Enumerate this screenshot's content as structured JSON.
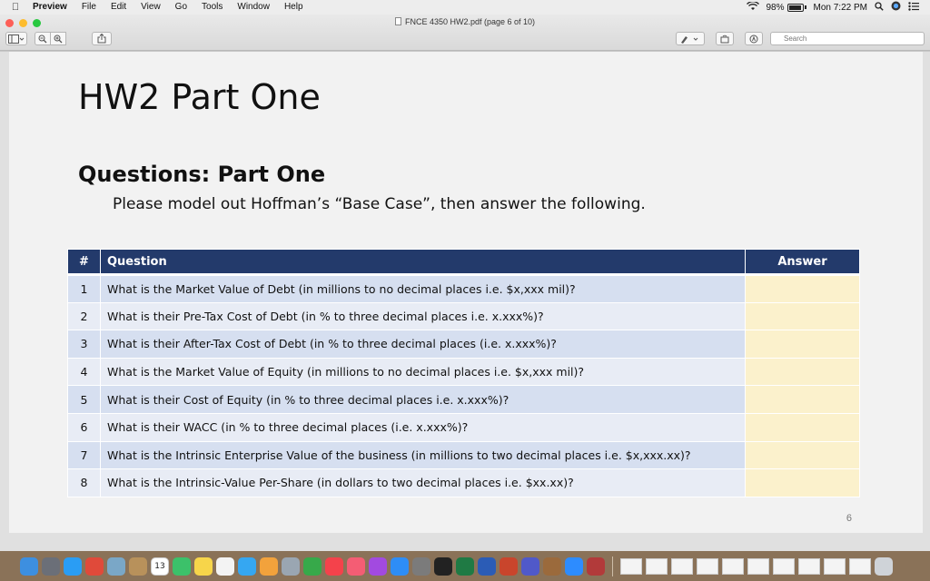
{
  "menubar": {
    "app_name": "Preview",
    "items": [
      "File",
      "Edit",
      "View",
      "Go",
      "Tools",
      "Window",
      "Help"
    ],
    "battery": "98%",
    "battery_level": 0.98,
    "clock": "Mon 7:22 PM"
  },
  "window": {
    "title": "FNCE 4350 HW2.pdf (page 6 of 10)",
    "search_placeholder": "Search"
  },
  "document": {
    "title": "HW2 Part One",
    "section_title": "Questions: Part One",
    "instruction": "Please model out Hoffman’s “Base Case”, then answer the following.",
    "page_number": "6",
    "table": {
      "headers": {
        "num": "#",
        "question": "Question",
        "answer": "Answer"
      },
      "rows": [
        {
          "num": "1",
          "question": "What is the Market Value of Debt (in millions to no decimal places i.e. $x,xxx mil)?",
          "answer": ""
        },
        {
          "num": "2",
          "question": "What is their Pre-Tax Cost of Debt (in % to three decimal places i.e. x.xxx%)?",
          "answer": ""
        },
        {
          "num": "3",
          "question": "What is their After-Tax Cost of Debt (in % to three decimal places (i.e. x.xxx%)?",
          "answer": ""
        },
        {
          "num": "4",
          "question": "What is the Market Value of Equity (in millions to no decimal places i.e. $x,xxx mil)?",
          "answer": ""
        },
        {
          "num": "5",
          "question": "What is their Cost of Equity (in % to three decimal places i.e. x.xxx%)?",
          "answer": ""
        },
        {
          "num": "6",
          "question": "What is their WACC (in % to three decimal places (i.e. x.xxx%)?",
          "answer": ""
        },
        {
          "num": "7",
          "question": "What is the Intrinsic Enterprise Value of the business (in millions to two decimal places i.e. $x,xxx.xx)?",
          "answer": ""
        },
        {
          "num": "8",
          "question": "What is the Intrinsic-Value Per-Share (in dollars to two decimal places i.e. $xx.xx)?",
          "answer": ""
        }
      ]
    }
  },
  "dock": {
    "calendar_day": "13",
    "apps": [
      {
        "icon": "finder-icon",
        "color": "#3d8fe0"
      },
      {
        "icon": "launchpad-icon",
        "color": "#6b6f78"
      },
      {
        "icon": "safari-icon",
        "color": "#2a9df4"
      },
      {
        "icon": "chrome-icon",
        "color": "#e04a3a"
      },
      {
        "icon": "preview-icon",
        "color": "#7aa7c7"
      },
      {
        "icon": "notes-paper-icon",
        "color": "#b8915b"
      },
      {
        "icon": "calendar-icon",
        "color": "#ffffff"
      },
      {
        "icon": "facetime-icon",
        "color": "#3cc16a"
      },
      {
        "icon": "notes-icon",
        "color": "#f7d54a"
      },
      {
        "icon": "reminders-icon",
        "color": "#f3f3f3"
      },
      {
        "icon": "messages-icon",
        "color": "#35a7f2"
      },
      {
        "icon": "photos-icon",
        "color": "#f2a23c"
      },
      {
        "icon": "image-capture-icon",
        "color": "#9aa6b2"
      },
      {
        "icon": "numbers-icon",
        "color": "#37a94a"
      },
      {
        "icon": "news-icon",
        "color": "#f4424b"
      },
      {
        "icon": "music-icon",
        "color": "#f45d74"
      },
      {
        "icon": "podcasts-icon",
        "color": "#a24ae0"
      },
      {
        "icon": "app-store-icon",
        "color": "#2e8df6"
      },
      {
        "icon": "system-preferences-icon",
        "color": "#7b7b7b"
      },
      {
        "icon": "terminal-icon",
        "color": "#222222"
      },
      {
        "icon": "excel-icon",
        "color": "#1f7a44"
      },
      {
        "icon": "word-icon",
        "color": "#2b5cb6"
      },
      {
        "icon": "powerpoint-icon",
        "color": "#c9452c"
      },
      {
        "icon": "teams-icon",
        "color": "#5059c9"
      },
      {
        "icon": "book-icon",
        "color": "#9b6a3c"
      },
      {
        "icon": "zoom-icon",
        "color": "#2d8cff"
      },
      {
        "icon": "photo-booth-icon",
        "color": "#b23a3a"
      }
    ],
    "documents": 10
  }
}
